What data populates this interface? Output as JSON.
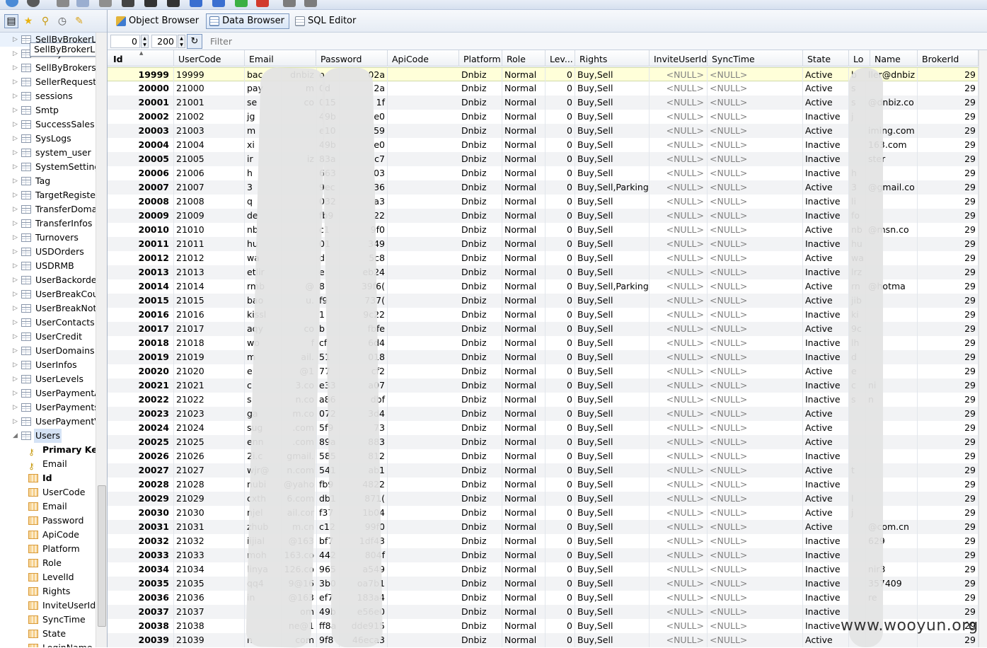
{
  "tabs": [
    {
      "label": "Object Browser",
      "icon": "object-browser-icon"
    },
    {
      "label": "Data Browser",
      "icon": "data-browser-icon",
      "active": true
    },
    {
      "label": "SQL Editor",
      "icon": "sql-editor-icon"
    }
  ],
  "pager": {
    "offset": "0",
    "limit": "200",
    "filter_placeholder": "Filter"
  },
  "sidebar": {
    "tooltip": "SellByBrokerL",
    "tables": [
      "SellByBrokerL",
      "SellByBrokerR",
      "SellByBrokers",
      "SellerRequests",
      "sessions",
      "Smtp",
      "SuccessSales",
      "SysLogs",
      "system_user",
      "SystemSetting:",
      "Tag",
      "TargetRegister",
      "TransferDoma",
      "TransferInfos",
      "Turnovers",
      "USDOrders",
      "USDRMB",
      "UserBackorde",
      "UserBreakCou",
      "UserBreakNot",
      "UserContacts",
      "UserCredit",
      "UserDomains",
      "UserInfos",
      "UserLevels",
      "UserPaymentA",
      "UserPayments",
      "UserPaymentV",
      "Users"
    ],
    "selected_table": "Users",
    "users_children": [
      {
        "label": "Primary Key",
        "type": "key",
        "bold": true
      },
      {
        "label": "Email",
        "type": "key",
        "bold": false
      },
      {
        "label": "Id",
        "type": "column",
        "bold": true
      },
      {
        "label": "UserCode",
        "type": "column",
        "bold": false
      },
      {
        "label": "Email",
        "type": "column",
        "bold": false
      },
      {
        "label": "Password",
        "type": "column",
        "bold": false
      },
      {
        "label": "ApiCode",
        "type": "column",
        "bold": false
      },
      {
        "label": "Platform",
        "type": "column",
        "bold": false
      },
      {
        "label": "Role",
        "type": "column",
        "bold": false
      },
      {
        "label": "LevelId",
        "type": "column",
        "bold": false
      },
      {
        "label": "Rights",
        "type": "column",
        "bold": false
      },
      {
        "label": "InviteUserId",
        "type": "column",
        "bold": false
      },
      {
        "label": "SyncTime",
        "type": "column",
        "bold": false
      },
      {
        "label": "State",
        "type": "column",
        "bold": false
      },
      {
        "label": "LoginName",
        "type": "column",
        "bold": false
      }
    ]
  },
  "grid": {
    "columns": [
      "Id",
      "UserCode",
      "Email",
      "Password",
      "ApiCode",
      "Platform",
      "Role",
      "Lev...",
      "Rights",
      "InviteUserId",
      "SyncTime",
      "State",
      "Lo",
      "Name",
      "BrokerId"
    ],
    "rows": [
      [
        "19999",
        "19999",
        "bac",
        "dnbiz",
        "o",
        "02a",
        "Dnbiz",
        "Normal",
        "0",
        "Buy,Sell",
        "<NULL>",
        "<NULL>",
        "Active",
        "b",
        "ller@dnbiz",
        "29"
      ],
      [
        "20000",
        "21000",
        "pay",
        "m",
        "0d",
        "2a",
        "Dnbiz",
        "Normal",
        "0",
        "Buy,Sell",
        "<NULL>",
        "<NULL>",
        "Active",
        "s",
        "",
        "29"
      ],
      [
        "20001",
        "21001",
        "se",
        "co",
        "015",
        "1f",
        "Dnbiz",
        "Normal",
        "0",
        "Buy,Sell",
        "<NULL>",
        "<NULL>",
        "Active",
        "s",
        "@dnbiz.co",
        "29"
      ],
      [
        "20002",
        "21002",
        "jg",
        "",
        "49b",
        "e0",
        "Dnbiz",
        "Normal",
        "0",
        "Buy,Sell",
        "<NULL>",
        "<NULL>",
        "Inactive",
        "j",
        "",
        "29"
      ],
      [
        "20003",
        "21003",
        "m",
        "",
        "e10",
        "59",
        "Dnbiz",
        "Normal",
        "0",
        "Buy,Sell",
        "<NULL>",
        "<NULL>",
        "Active",
        "",
        "iming.com",
        "29"
      ],
      [
        "20004",
        "21004",
        "xi",
        "",
        "49b",
        "e0",
        "Dnbiz",
        "Normal",
        "0",
        "Buy,Sell",
        "<NULL>",
        "<NULL>",
        "Inactive",
        "",
        "163.com",
        "29"
      ],
      [
        "20005",
        "21005",
        "ir",
        "iz",
        "83a",
        "c7",
        "Dnbiz",
        "Normal",
        "0",
        "Buy,Sell",
        "<NULL>",
        "<NULL>",
        "Inactive",
        "",
        "ster",
        "29"
      ],
      [
        "20006",
        "21006",
        "h",
        "",
        "663",
        "03",
        "Dnbiz",
        "Normal",
        "0",
        "Buy,Sell",
        "<NULL>",
        "<NULL>",
        "Inactive",
        "h",
        "",
        "29"
      ],
      [
        "20007",
        "21007",
        "3",
        "",
        "9ec",
        "36",
        "Dnbiz",
        "Normal",
        "0",
        "Buy,Sell,Parking",
        "<NULL>",
        "<NULL>",
        "Active",
        "3",
        "@gmail.co",
        "29"
      ],
      [
        "20008",
        "21008",
        "q",
        "",
        "032",
        "a3",
        "Dnbiz",
        "Normal",
        "0",
        "Buy,Sell",
        "<NULL>",
        "<NULL>",
        "Inactive",
        "li",
        "",
        "29"
      ],
      [
        "20009",
        "21009",
        "de",
        "",
        "fb9",
        "22",
        "Dnbiz",
        "Normal",
        "0",
        "Buy,Sell",
        "<NULL>",
        "<NULL>",
        "Inactive",
        "fo",
        "",
        "29"
      ],
      [
        "20010",
        "21010",
        "nb",
        "",
        "c1",
        "9f0",
        "Dnbiz",
        "Normal",
        "0",
        "Buy,Sell",
        "<NULL>",
        "<NULL>",
        "Active",
        "nb",
        "@msn.co",
        "29"
      ],
      [
        "20011",
        "21011",
        "hu",
        "",
        "01",
        "349",
        "Dnbiz",
        "Normal",
        "0",
        "Buy,Sell",
        "<NULL>",
        "<NULL>",
        "Inactive",
        "hu",
        "",
        "29"
      ],
      [
        "20012",
        "21012",
        "wa",
        "",
        "d",
        "5c8",
        "Dnbiz",
        "Normal",
        "0",
        "Buy,Sell",
        "<NULL>",
        "<NULL>",
        "Active",
        "wa",
        "",
        "29"
      ],
      [
        "20013",
        "21013",
        "etlir",
        "",
        "e",
        "eb24",
        "Dnbiz",
        "Normal",
        "0",
        "Buy,Sell",
        "<NULL>",
        "<NULL>",
        "Inactive",
        "lrz",
        "",
        "29"
      ],
      [
        "20014",
        "21014",
        "rmb",
        "@",
        "8",
        "39f6(",
        "Dnbiz",
        "Normal",
        "0",
        "Buy,Sell,Parking",
        "<NULL>",
        "<NULL>",
        "Active",
        "rn",
        "@hotma",
        "29"
      ],
      [
        "20015",
        "21015",
        "bao",
        "u.",
        "f9",
        "737(",
        "Dnbiz",
        "Normal",
        "0",
        "Buy,Sell",
        "<NULL>",
        "<NULL>",
        "Active",
        "jib",
        "",
        "29"
      ],
      [
        "20016",
        "21016",
        "kissl",
        "",
        "1",
        "9c22",
        "Dnbiz",
        "Normal",
        "0",
        "Buy,Sell",
        "<NULL>",
        "<NULL>",
        "Inactive",
        "ki",
        "",
        "29"
      ],
      [
        "20017",
        "21017",
        "aqy",
        "co",
        "b",
        "fbfe",
        "Dnbiz",
        "Normal",
        "0",
        "Buy,Sell",
        "<NULL>",
        "<NULL>",
        "Active",
        "9c",
        "",
        "29"
      ],
      [
        "20018",
        "21018",
        "wo",
        "f",
        "cf",
        "6d4",
        "Dnbiz",
        "Normal",
        "0",
        "Buy,Sell",
        "<NULL>",
        "<NULL>",
        "Inactive",
        "lh",
        "",
        "29"
      ],
      [
        "20019",
        "21019",
        "m",
        "ail.",
        "51",
        "018",
        "Dnbiz",
        "Normal",
        "0",
        "Buy,Sell",
        "<NULL>",
        "<NULL>",
        "Inactive",
        "d",
        "",
        "29"
      ],
      [
        "20020",
        "21020",
        "e",
        "@1",
        "77",
        "cf2",
        "Dnbiz",
        "Normal",
        "0",
        "Buy,Sell",
        "<NULL>",
        "<NULL>",
        "Active",
        "e",
        "",
        "29"
      ],
      [
        "20021",
        "21021",
        "c",
        "3.co",
        "e33",
        "a07",
        "Dnbiz",
        "Normal",
        "0",
        "Buy,Sell",
        "<NULL>",
        "<NULL>",
        "Inactive",
        "c",
        "ni",
        "29"
      ],
      [
        "20022",
        "21022",
        "s",
        "n.co",
        "a86",
        "dbf",
        "Dnbiz",
        "Normal",
        "0",
        "Buy,Sell",
        "<NULL>",
        "<NULL>",
        "Inactive",
        "s",
        "n",
        "29"
      ],
      [
        "20023",
        "21023",
        "ga",
        "m.co",
        "072",
        "3d4",
        "Dnbiz",
        "Normal",
        "0",
        "Buy,Sell",
        "<NULL>",
        "<NULL>",
        "Active",
        "",
        "",
        "29"
      ],
      [
        "20024",
        "21024",
        "sug",
        ".com",
        "5f9",
        "73",
        "Dnbiz",
        "Normal",
        "0",
        "Buy,Sell",
        "<NULL>",
        "<NULL>",
        "Active",
        "",
        "",
        "29"
      ],
      [
        "20025",
        "21025",
        "enn",
        ".com",
        "89a",
        "883",
        "Dnbiz",
        "Normal",
        "0",
        "Buy,Sell",
        "<NULL>",
        "<NULL>",
        "Active",
        "",
        "",
        "29"
      ],
      [
        "20026",
        "21026",
        "2i.c",
        "gmail.",
        "585",
        "812",
        "Dnbiz",
        "Normal",
        "0",
        "Buy,Sell",
        "<NULL>",
        "<NULL>",
        "Inactive",
        "",
        "",
        "29"
      ],
      [
        "20027",
        "21027",
        "wjr@",
        "n.com",
        "541",
        "ab1",
        "Dnbiz",
        "Normal",
        "0",
        "Buy,Sell",
        "<NULL>",
        "<NULL>",
        "Active",
        "t",
        "",
        "29"
      ],
      [
        "20028",
        "21028",
        "nubi",
        "@yaho",
        "fb9",
        "4822",
        "Dnbiz",
        "Normal",
        "0",
        "Buy,Sell",
        "<NULL>",
        "<NULL>",
        "Inactive",
        "",
        "",
        "29"
      ],
      [
        "20029",
        "21029",
        "cxth",
        "6.com",
        "db1",
        "871(",
        "Dnbiz",
        "Normal",
        "0",
        "Buy,Sell",
        "<NULL>",
        "<NULL>",
        "Active",
        "l",
        "",
        "29"
      ],
      [
        "20030",
        "21030",
        "njel",
        "ail.cor",
        "f37",
        "1b04",
        "Dnbiz",
        "Normal",
        "0",
        "Buy,Sell",
        "<NULL>",
        "<NULL>",
        "Active",
        "j",
        "",
        "29"
      ],
      [
        "20031",
        "21031",
        "zhub",
        "m.cn",
        "c12",
        "99f0",
        "Dnbiz",
        "Normal",
        "0",
        "Buy,Sell",
        "<NULL>",
        "<NULL>",
        "Active",
        "",
        "@com.cn",
        "29"
      ],
      [
        "20032",
        "21032",
        "iijial",
        "@163",
        "bf7",
        "1df43",
        "Dnbiz",
        "Normal",
        "0",
        "Buy,Sell",
        "<NULL>",
        "<NULL>",
        "Inactive",
        "",
        "629",
        "29"
      ],
      [
        "20033",
        "21033",
        "moh",
        "163.co",
        "442",
        "804f",
        "Dnbiz",
        "Normal",
        "0",
        "Buy,Sell",
        "<NULL>",
        "<NULL>",
        "Inactive",
        "",
        "",
        "29"
      ],
      [
        "20034",
        "21034",
        "linya",
        "126.co",
        "965",
        "a549",
        "Dnbiz",
        "Normal",
        "0",
        "Buy,Sell",
        "<NULL>",
        "<NULL>",
        "Inactive",
        "",
        "nir3",
        "29"
      ],
      [
        "20035",
        "21035",
        "qq4",
        "9@16",
        "3b0",
        "oa7b1",
        "Dnbiz",
        "Normal",
        "0",
        "Buy,Sell",
        "<NULL>",
        "<NULL>",
        "Inactive",
        "",
        "357409",
        "29"
      ],
      [
        "20036",
        "21036",
        "in",
        "@163",
        "ef7",
        "183a4",
        "Dnbiz",
        "Normal",
        "0",
        "Buy,Sell",
        "<NULL>",
        "<NULL>",
        "Inactive",
        "",
        "re",
        "29"
      ],
      [
        "20037",
        "21037",
        "",
        "om",
        "49b",
        "e56e0",
        "Dnbiz",
        "Normal",
        "0",
        "Buy,Sell",
        "<NULL>",
        "<NULL>",
        "Inactive",
        "",
        "",
        "29"
      ],
      [
        "20038",
        "21038",
        "",
        "ne@1",
        "ff8a",
        "dde915",
        "Dnbiz",
        "Normal",
        "0",
        "Buy,Sell",
        "<NULL>",
        "<NULL>",
        "Inactive",
        "",
        "",
        "29"
      ],
      [
        "20039",
        "21039",
        "n",
        "com",
        "9f8",
        "46eca3",
        "Dnbiz",
        "Normal",
        "0",
        "Buy,Sell",
        "<NULL>",
        "<NULL>",
        "Active",
        "",
        "",
        "29"
      ]
    ]
  },
  "watermark": "www.wooyun.org"
}
